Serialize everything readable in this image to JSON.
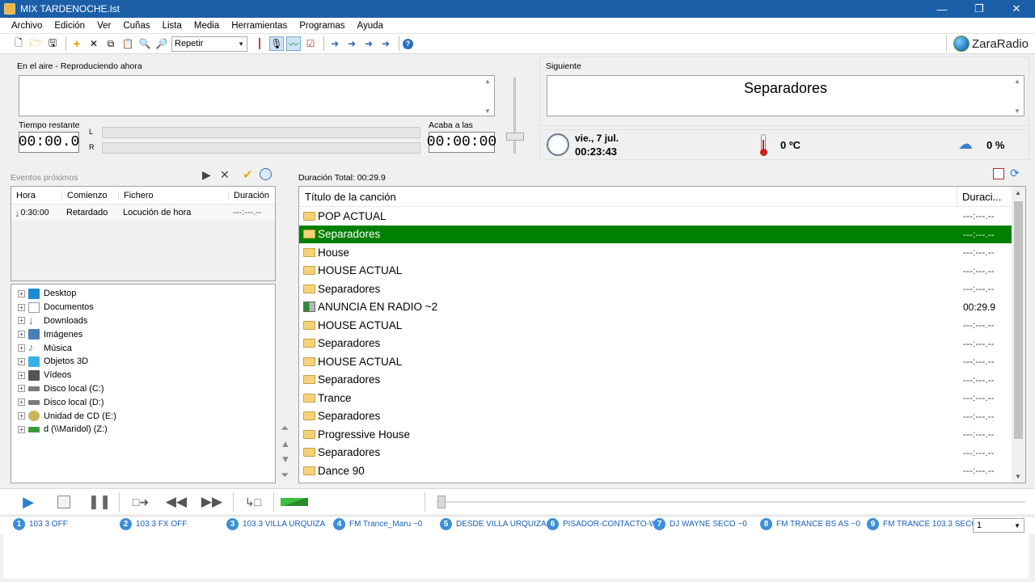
{
  "window": {
    "title": "MIX TARDENOCHE.lst",
    "minimize": "—",
    "maximize": "❐",
    "close": "✕"
  },
  "menu": [
    "Archivo",
    "Edición",
    "Ver",
    "Cuñas",
    "Lista",
    "Media",
    "Herramientas",
    "Programas",
    "Ayuda"
  ],
  "toolbar": {
    "mode_select": "Repetir",
    "logo": "ZaraRadio"
  },
  "on_air": {
    "label": "En el aire - Reproduciendo ahora",
    "remaining_label": "Tiempo restante",
    "remaining": "00:00.0",
    "ends_label": "Acaba a las",
    "ends": "00:00:00",
    "L": "L",
    "R": "R"
  },
  "next": {
    "label": "Siguiente",
    "title": "Separadores"
  },
  "status": {
    "date": "vie., 7 jul.",
    "time": "00:23:43",
    "temperature": "0 ºC",
    "rain": "0 %"
  },
  "events": {
    "label": "Eventos próximos",
    "columns": [
      "Hora",
      "Comienzo",
      "Fichero",
      "Duración"
    ],
    "rows": [
      {
        "hora": "0:30:00",
        "comienzo": "Retardado",
        "fichero": "Locución de hora",
        "duracion": "---:---.--"
      }
    ]
  },
  "tree": [
    {
      "label": "Desktop",
      "color": "#1e8ad6"
    },
    {
      "label": "Documentos",
      "color": "#8a9aae"
    },
    {
      "label": "Downloads",
      "color": "#2d7fd8"
    },
    {
      "label": "Imágenes",
      "color": "#4a7eb8"
    },
    {
      "label": "Música",
      "color": "#2b8ce0"
    },
    {
      "label": "Objetos 3D",
      "color": "#3ab0e8"
    },
    {
      "label": "Vídeos",
      "color": "#555555"
    },
    {
      "label": "Disco local (C:)",
      "color": "#7a7a7a"
    },
    {
      "label": "Disco local (D:)",
      "color": "#7a7a7a"
    },
    {
      "label": "Unidad de CD (E:)",
      "color": "#c8b45a"
    },
    {
      "label": "d (\\\\Maridol) (Z:)",
      "color": "#3a9a3a"
    }
  ],
  "playlist": {
    "total": "Duración Total: 00:29.9",
    "columns": [
      "Título de la canción",
      "Duraci..."
    ],
    "rows": [
      {
        "title": "POP ACTUAL",
        "duration": "---:---.--",
        "type": "folder"
      },
      {
        "title": "Separadores",
        "duration": "---:---.--",
        "type": "folder",
        "selected": true
      },
      {
        "title": "House",
        "duration": "---:---.--",
        "type": "folder"
      },
      {
        "title": "HOUSE ACTUAL",
        "duration": "---:---.--",
        "type": "folder"
      },
      {
        "title": "Separadores",
        "duration": "---:---.--",
        "type": "folder"
      },
      {
        "title": "ANUNCIA EN RADIO ~2",
        "duration": "00:29.9",
        "type": "audio"
      },
      {
        "title": "HOUSE ACTUAL",
        "duration": "---:---.--",
        "type": "folder"
      },
      {
        "title": "Separadores",
        "duration": "---:---.--",
        "type": "folder"
      },
      {
        "title": "HOUSE ACTUAL",
        "duration": "---:---.--",
        "type": "folder"
      },
      {
        "title": "Separadores",
        "duration": "---:---.--",
        "type": "folder"
      },
      {
        "title": "Trance",
        "duration": "---:---.--",
        "type": "folder"
      },
      {
        "title": "Separadores",
        "duration": "---:---.--",
        "type": "folder"
      },
      {
        "title": "Progressive House",
        "duration": "---:---.--",
        "type": "folder"
      },
      {
        "title": "Separadores",
        "duration": "---:---.--",
        "type": "folder"
      },
      {
        "title": "Dance 90",
        "duration": "---:---.--",
        "type": "folder"
      }
    ]
  },
  "carts": [
    {
      "n": "1",
      "label": "103 3 OFF"
    },
    {
      "n": "2",
      "label": "103 3 FX OFF"
    },
    {
      "n": "3",
      "label": "103.3 VILLA URQUIZA"
    },
    {
      "n": "4",
      "label": "FM Trance_Maru ~0"
    },
    {
      "n": "5",
      "label": "DESDE VILLA URQUIZA"
    },
    {
      "n": "6",
      "label": "PISADOR-CONTACTO-W"
    },
    {
      "n": "7",
      "label": "DJ WAYNE SECO ~0"
    },
    {
      "n": "8",
      "label": "FM TRANCE BS AS ~0"
    },
    {
      "n": "9",
      "label": "FM TRANCE 103.3 SECO"
    }
  ],
  "cart_page": "1"
}
